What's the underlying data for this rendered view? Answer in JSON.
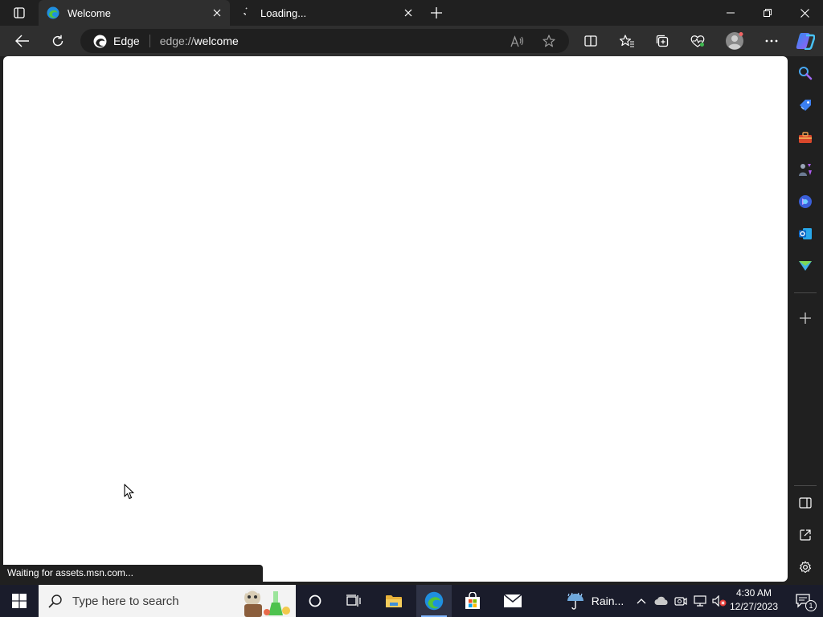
{
  "browser": {
    "tabs": [
      {
        "title": "Welcome",
        "active": true
      },
      {
        "title": "Loading...",
        "active": false
      }
    ],
    "omnibox": {
      "brand_label": "Edge",
      "url_scheme": "edge://",
      "url_host": "welcome"
    },
    "status_text": "Waiting for assets.msn.com..."
  },
  "sidebar": {
    "items": [
      "search-icon",
      "shopping-tag-icon",
      "toolbox-icon",
      "games-icon",
      "copilot-icon",
      "outlook-icon",
      "send-icon",
      "add-icon"
    ],
    "bottom_items": [
      "split-screen-icon",
      "open-external-icon",
      "settings-icon"
    ]
  },
  "taskbar": {
    "search_placeholder": "Type here to search",
    "weather_label": "Rain...",
    "clock_time": "4:30 AM",
    "clock_date": "12/27/2023",
    "notification_count": "1"
  },
  "colors": {
    "edge_blue": "#1f8fe0",
    "edge_green": "#52c53a",
    "copilot_gradient_a": "#2d8cf0",
    "copilot_gradient_b": "#9b5cf5"
  }
}
